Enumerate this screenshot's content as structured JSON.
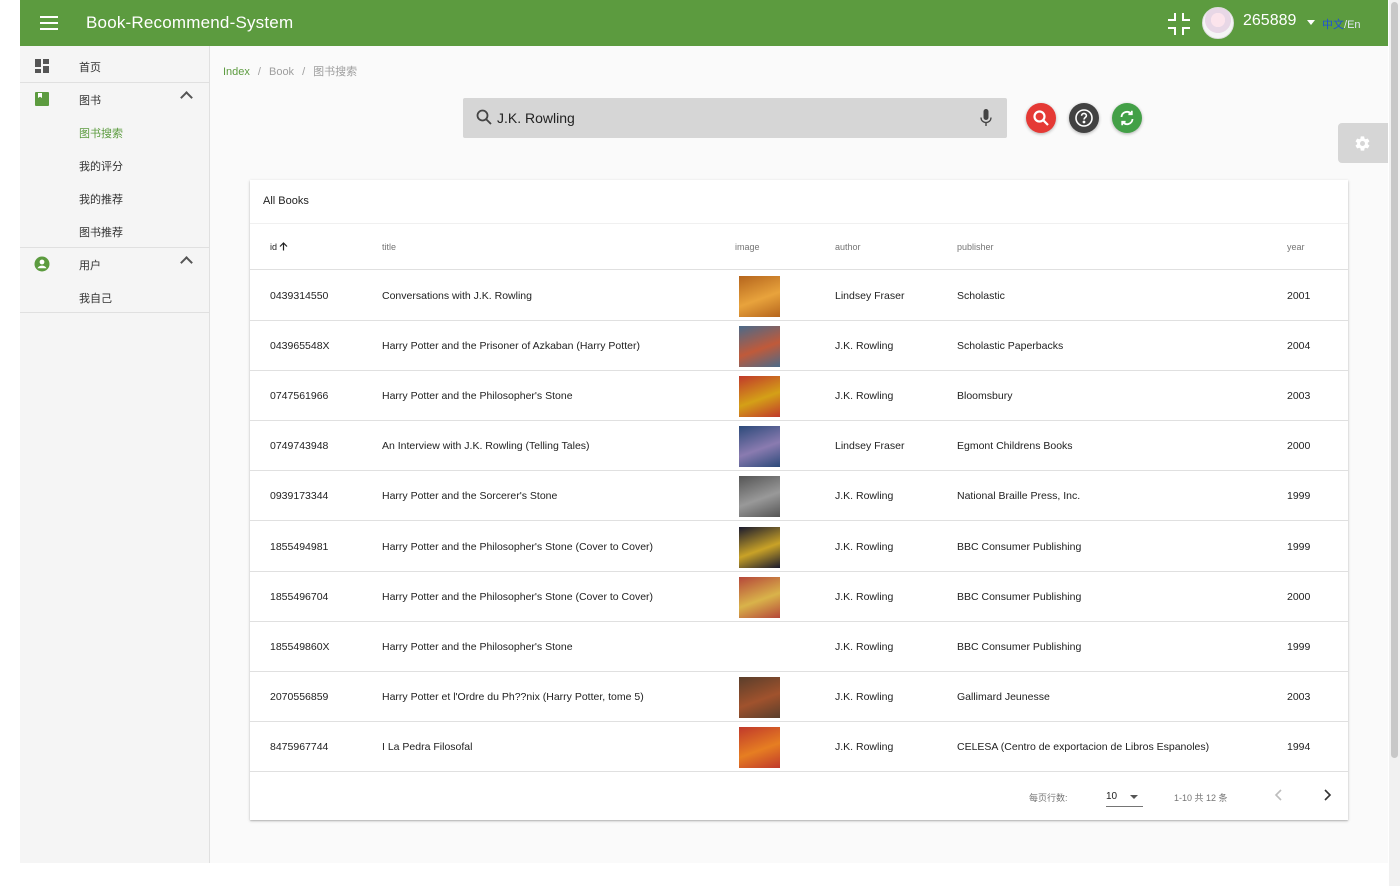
{
  "app": {
    "title": "Book-Recommend-System",
    "username": "265889",
    "lang_zh": "中文",
    "lang_sep": "/",
    "lang_en": "En",
    "accent": "#5c9b3f"
  },
  "sidebar": {
    "items": [
      {
        "label": "首页",
        "icon": "dashboard-icon"
      },
      {
        "label": "图书",
        "icon": "book-icon",
        "expanded": true
      },
      {
        "label": "图书搜索",
        "active": true
      },
      {
        "label": "我的评分"
      },
      {
        "label": "我的推荐"
      },
      {
        "label": "图书推荐"
      },
      {
        "label": "用户",
        "icon": "account-circle-icon",
        "expanded": true
      },
      {
        "label": "我自己"
      }
    ]
  },
  "breadcrumb": [
    "Index",
    "Book",
    "图书搜索"
  ],
  "breadcrumb_sep": "/",
  "search": {
    "value": "J.K. Rowling"
  },
  "buttons": {
    "search_color": "#e53935",
    "help_color": "#424242",
    "refresh_color": "#43a047"
  },
  "table": {
    "title": "All Books",
    "columns": [
      "id",
      "title",
      "image",
      "author",
      "publisher",
      "year"
    ],
    "sort_column": "id",
    "rows": [
      {
        "id": "0439314550",
        "title": "Conversations with J.K. Rowling",
        "has_image": true,
        "author": "Lindsey Fraser",
        "publisher": "Scholastic",
        "year": "2001"
      },
      {
        "id": "043965548X",
        "title": "Harry Potter and the Prisoner of Azkaban (Harry Potter)",
        "has_image": true,
        "author": "J.K. Rowling",
        "publisher": "Scholastic Paperbacks",
        "year": "2004"
      },
      {
        "id": "0747561966",
        "title": "Harry Potter and the Philosopher's Stone",
        "has_image": true,
        "author": "J.K. Rowling",
        "publisher": "Bloomsbury",
        "year": "2003"
      },
      {
        "id": "0749743948",
        "title": "An Interview with J.K. Rowling (Telling Tales)",
        "has_image": true,
        "author": "Lindsey Fraser",
        "publisher": "Egmont Childrens Books",
        "year": "2000"
      },
      {
        "id": "0939173344",
        "title": "Harry Potter and the Sorcerer's Stone",
        "has_image": true,
        "author": "J.K. Rowling",
        "publisher": "National Braille Press, Inc.",
        "year": "1999"
      },
      {
        "id": "1855494981",
        "title": "Harry Potter and the Philosopher's Stone (Cover to Cover)",
        "has_image": true,
        "author": "J.K. Rowling",
        "publisher": "BBC Consumer Publishing",
        "year": "1999"
      },
      {
        "id": "1855496704",
        "title": "Harry Potter and the Philosopher's Stone (Cover to Cover)",
        "has_image": true,
        "author": "J.K. Rowling",
        "publisher": "BBC Consumer Publishing",
        "year": "2000"
      },
      {
        "id": "185549860X",
        "title": "Harry Potter and the Philosopher's Stone",
        "has_image": false,
        "author": "J.K. Rowling",
        "publisher": "BBC Consumer Publishing",
        "year": "1999"
      },
      {
        "id": "2070556859",
        "title": "Harry Potter et l'Ordre du Ph??nix (Harry Potter, tome 5)",
        "has_image": true,
        "author": "J.K. Rowling",
        "publisher": "Gallimard Jeunesse",
        "year": "2003"
      },
      {
        "id": "8475967744",
        "title": "I La Pedra Filosofal",
        "has_image": true,
        "author": "J.K. Rowling",
        "publisher": "CELESA (Centro de exportacion de Libros Espanoles)",
        "year": "1994"
      }
    ]
  },
  "pagination": {
    "rows_per_page_label": "每页行数:",
    "rows_per_page": "10",
    "range_text": "1-10 共 12 条"
  }
}
